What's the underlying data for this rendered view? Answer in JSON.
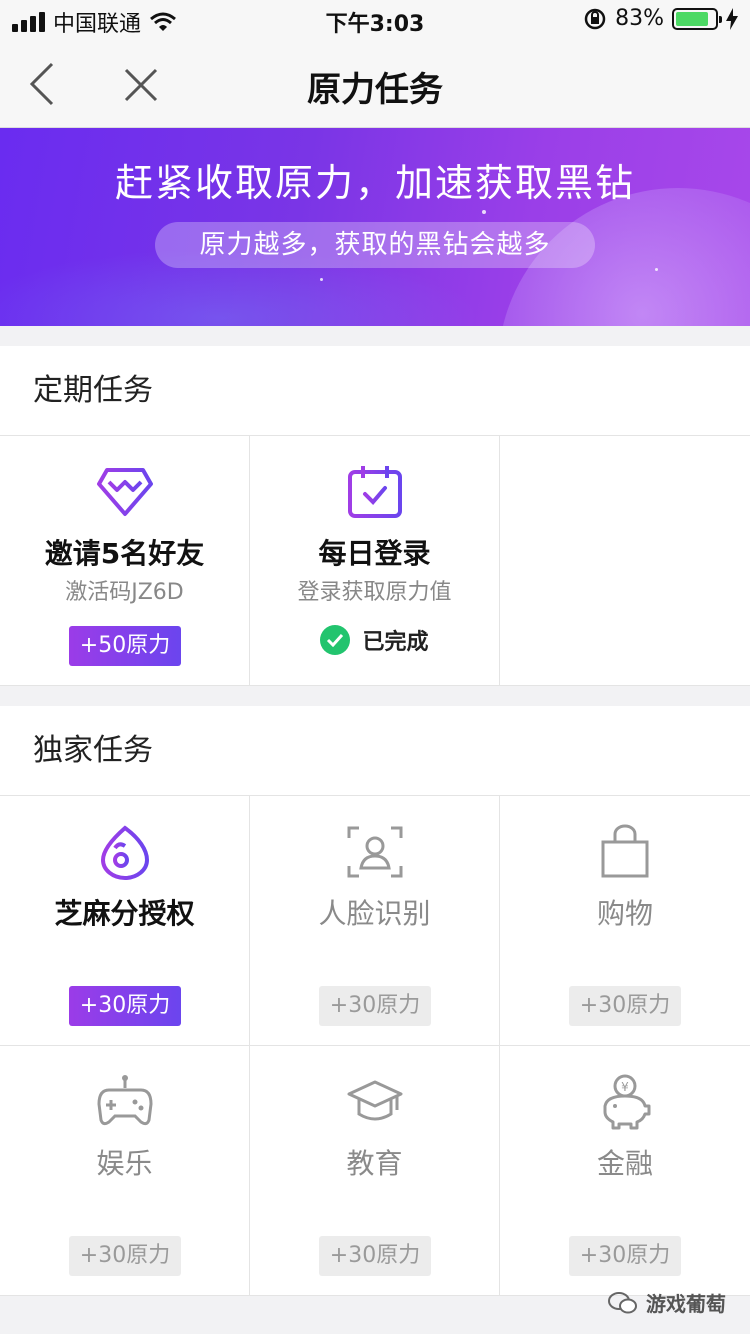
{
  "statusbar": {
    "carrier": "中国联通",
    "time": "下午3:03",
    "battery": "83%",
    "battery_level": 0.83
  },
  "nav": {
    "title": "原力任务",
    "back_icon": "chevron-left-icon",
    "close_icon": "close-icon"
  },
  "banner": {
    "headline": "赶紧收取原力，加速获取黑钻",
    "subline": "原力越多，获取的黑钻会越多"
  },
  "periodic": {
    "title": "定期任务",
    "tasks": [
      {
        "icon": "diamond-icon",
        "name": "邀请5名好友",
        "sub": "激活码JZ6D",
        "reward": "+50原力"
      },
      {
        "icon": "calendar-check-icon",
        "name": "每日登录",
        "sub": "登录获取原力值",
        "status": "已完成"
      }
    ]
  },
  "exclusive": {
    "title": "独家任务",
    "tasks": [
      {
        "icon": "sesame-icon",
        "name": "芝麻分授权",
        "reward": "+30原力"
      },
      {
        "icon": "face-scan-icon",
        "name": "人脸识别",
        "reward": "+30原力"
      },
      {
        "icon": "shopping-bag-icon",
        "name": "购物",
        "reward": "+30原力"
      },
      {
        "icon": "gamepad-icon",
        "name": "娱乐",
        "reward": "+30原力"
      },
      {
        "icon": "graduation-cap-icon",
        "name": "教育",
        "reward": "+30原力"
      },
      {
        "icon": "piggy-bank-icon",
        "name": "金融",
        "reward": "+30原力"
      }
    ]
  },
  "watermark": {
    "text": "游戏葡萄"
  },
  "colors": {
    "accent_start": "#9b3ce8",
    "accent_end": "#6b45ee",
    "done_green": "#22c46e"
  }
}
